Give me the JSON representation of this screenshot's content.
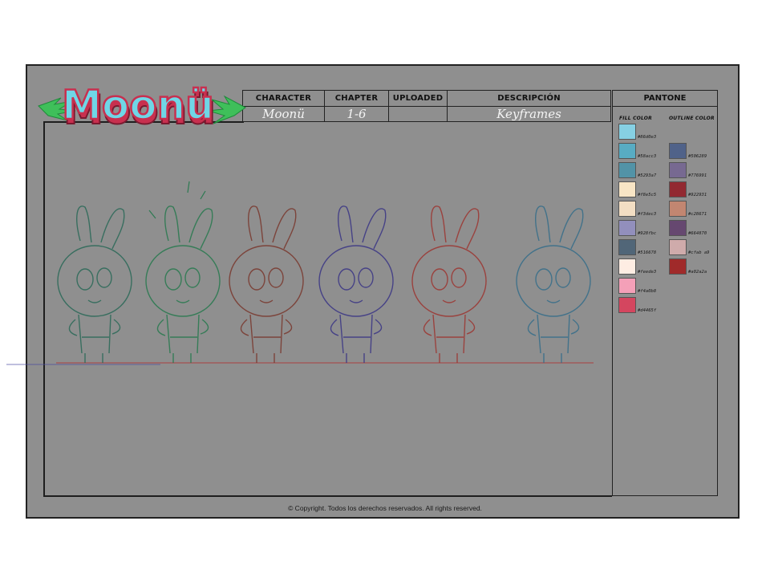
{
  "header": {
    "columns": [
      {
        "label": "CHARACTER",
        "value": "Moonü"
      },
      {
        "label": "CHAPTER",
        "value": "1-6"
      },
      {
        "label": "UPLOADED",
        "value": ""
      },
      {
        "label": "DESCRIPCIÓN",
        "value": "Keyframes"
      }
    ]
  },
  "logo": {
    "text": "Moonü"
  },
  "pantone": {
    "title": "PANTONE",
    "fill_label": "FILL COLOR",
    "outline_label": "OUTLINE COLOR",
    "fill_colors": [
      {
        "hex": "#86d0e3",
        "code": "#86d0e3"
      },
      {
        "hex": "#58acc3",
        "code": "#58acc3"
      },
      {
        "hex": "#5293a7",
        "code": "#5293a7"
      },
      {
        "hex": "#f8e5c5",
        "code": "#f8e5c5"
      },
      {
        "hex": "#f3dec3",
        "code": "#f3dec3"
      },
      {
        "hex": "#928fbc",
        "code": "#928fbc"
      },
      {
        "hex": "#516678",
        "code": "#516678"
      },
      {
        "hex": "#feede3",
        "code": "#feede3"
      },
      {
        "hex": "#f4a0b8",
        "code": "#f4a0b8"
      },
      {
        "hex": "#d4465f",
        "code": "#d4465f"
      }
    ],
    "outline_colors": [
      {
        "hex": "#506289",
        "code": "#506289"
      },
      {
        "hex": "#776991",
        "code": "#776991"
      },
      {
        "hex": "#922931",
        "code": "#922931"
      },
      {
        "hex": "#c28671",
        "code": "#c28671"
      },
      {
        "hex": "#664870",
        "code": "#664870"
      },
      {
        "hex": "#cfabab",
        "code": "#cfab a9"
      },
      {
        "hex": "#a02a2a",
        "code": "#a02a2a"
      }
    ]
  },
  "sketch_colors": [
    "#2f6b5a",
    "#2d7a52",
    "#7a3c32",
    "#3f3a86",
    "#9c3a36",
    "#3a6f8a"
  ],
  "footer": {
    "copyright": "© Copyright. Todos los derechos reservados. All rights reserved."
  }
}
